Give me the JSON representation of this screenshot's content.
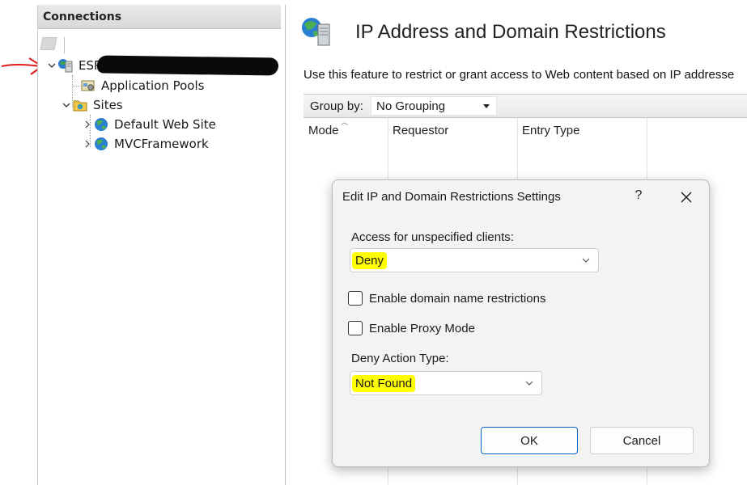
{
  "connections": {
    "header": "Connections",
    "server_label": "ESR",
    "tree": {
      "app_pools": "Application Pools",
      "sites": "Sites",
      "default_site": "Default Web Site",
      "mvc_site": "MVCFramework"
    }
  },
  "feature": {
    "title": "IP Address and Domain Restrictions",
    "description": "Use this feature to restrict or grant access to Web content based on IP addresse",
    "group_by_label": "Group by:",
    "group_by_value": "No Grouping",
    "columns": [
      "Mode",
      "Requestor",
      "Entry Type"
    ]
  },
  "dialog": {
    "title": "Edit IP and Domain Restrictions Settings",
    "help_glyph": "?",
    "access_label": "Access for unspecified clients:",
    "access_value": "Deny",
    "domain_checkbox_label": "Enable domain name restrictions",
    "domain_checked": false,
    "proxy_checkbox_label": "Enable Proxy Mode",
    "proxy_checked": false,
    "deny_action_label": "Deny Action Type:",
    "deny_action_value": "Not Found",
    "ok_label": "OK",
    "cancel_label": "Cancel"
  },
  "annotations": {
    "highlight_color": "#ffff00",
    "arrow_color": "#e01b1b",
    "redaction_color": "#0a0a0a"
  }
}
